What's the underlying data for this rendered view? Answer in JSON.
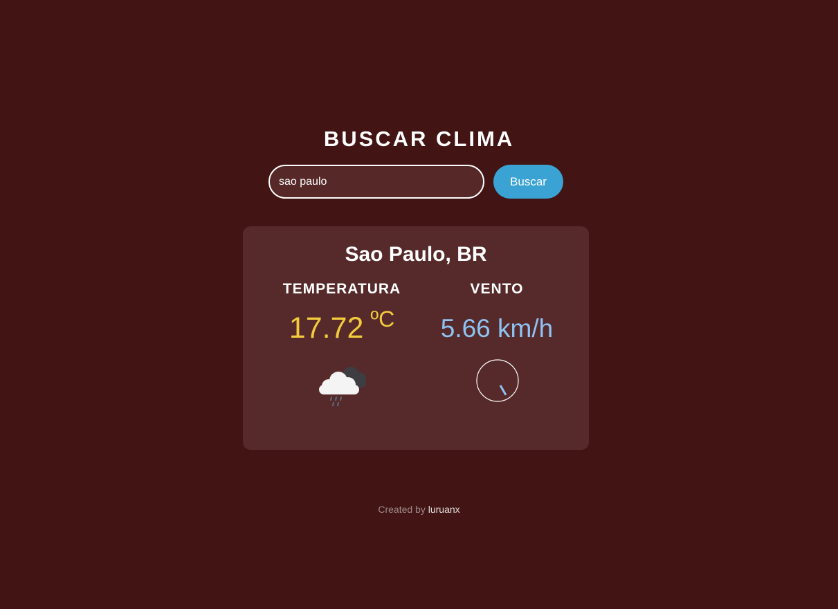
{
  "header": {
    "title": "BUSCAR CLIMA"
  },
  "search": {
    "value": "sao paulo",
    "button_label": "Buscar"
  },
  "weather": {
    "city": "Sao Paulo, BR",
    "temperature_label": "TEMPERATURA",
    "temperature_value": "17.72",
    "temperature_unit": "ºC",
    "wind_label": "VENTO",
    "wind_value": "5.66 km/h",
    "wind_direction_deg": 150,
    "condition_icon": "rain-cloud-icon"
  },
  "footer": {
    "prefix": "Created by",
    "author": "luruanx"
  },
  "colors": {
    "background": "#421414",
    "card": "#562a2b",
    "accent_button": "#3ba3d4",
    "temperature": "#f2cb3d",
    "wind": "#8ec4f4"
  }
}
